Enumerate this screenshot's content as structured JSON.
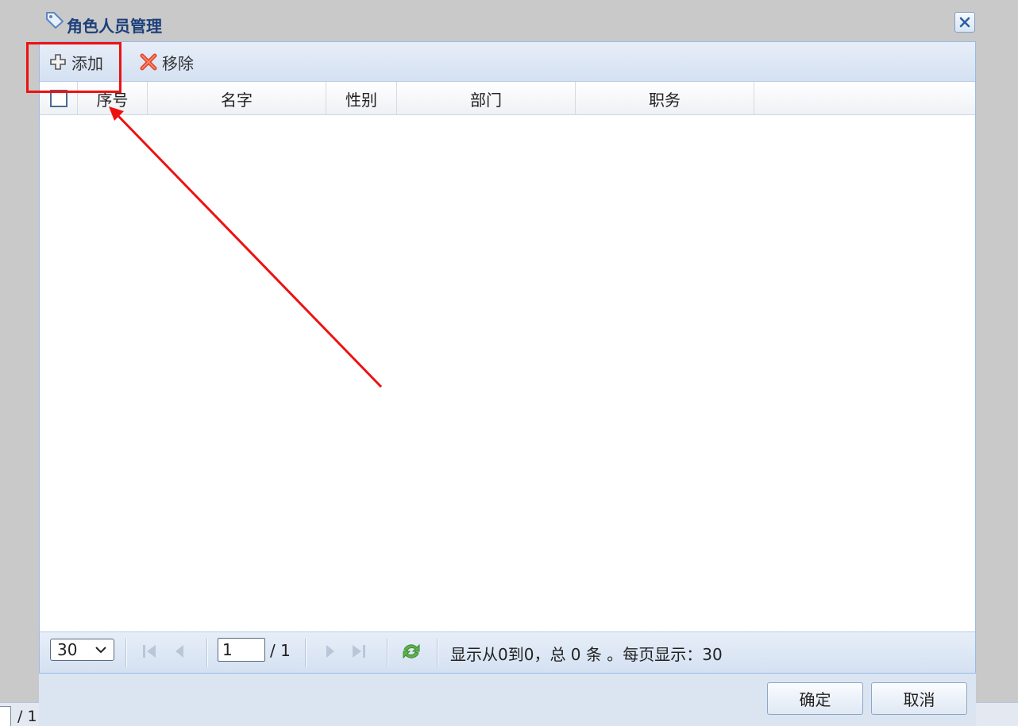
{
  "background_page": {
    "pager_text": "/ 1"
  },
  "dialog": {
    "title": "角色人员管理",
    "toolbar": {
      "add_label": "添加",
      "remove_label": "移除"
    },
    "grid": {
      "columns": [
        "序号",
        "名字",
        "性别",
        "部门",
        "职务"
      ],
      "rows": []
    },
    "pager": {
      "page_size_selected": "30",
      "current_page": "1",
      "total_pages_text": "/ 1",
      "info_text": "显示从0到0，总 0 条 。每页显示：30"
    },
    "footer": {
      "ok_label": "确定",
      "cancel_label": "取消"
    }
  },
  "annotation": {
    "color": "#ee1111"
  },
  "colors": {
    "title": "#1b3f7a",
    "panel_border": "#99bbe8",
    "toolbar_bg": "#d4e1f2"
  }
}
